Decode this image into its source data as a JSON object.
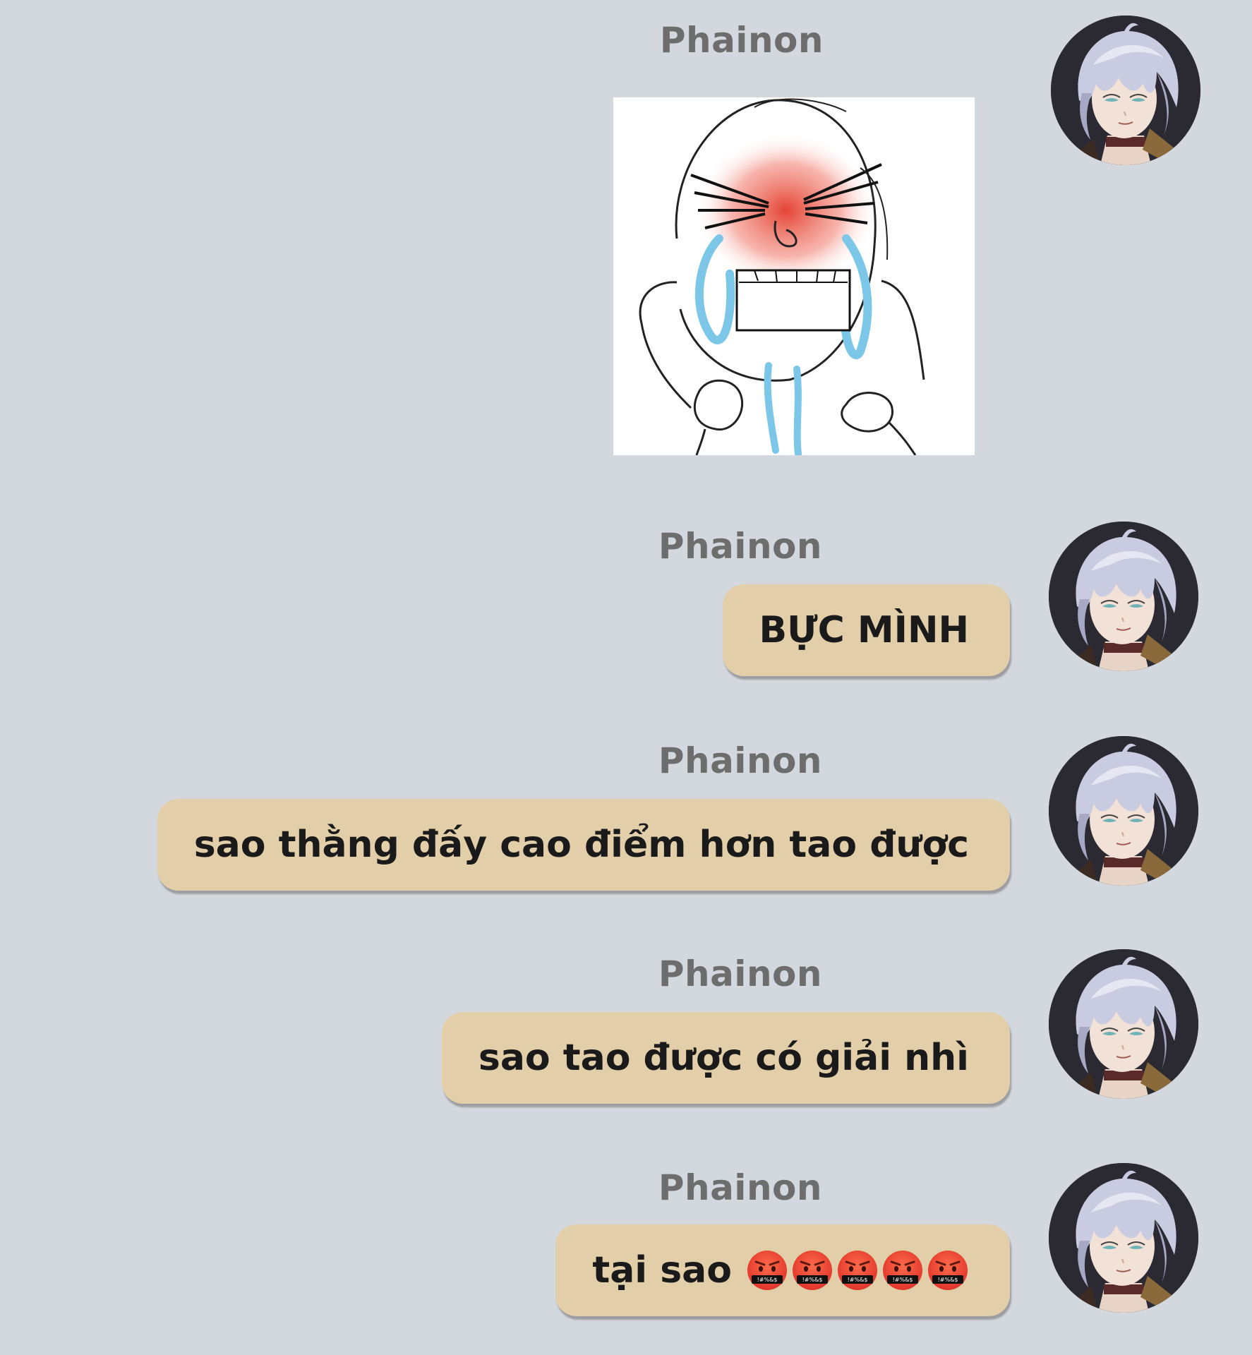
{
  "messages": [
    {
      "sender": "Phainon",
      "type": "sticker",
      "avatar": "phainon-avatar"
    },
    {
      "sender": "Phainon",
      "type": "text",
      "text": "BỰC MÌNH",
      "avatar": "phainon-avatar"
    },
    {
      "sender": "Phainon",
      "type": "text",
      "text": "sao thằng đấy cao điểm hơn tao được",
      "avatar": "phainon-avatar"
    },
    {
      "sender": "Phainon",
      "type": "text",
      "text": "sao tao được có giải nhì",
      "avatar": "phainon-avatar"
    },
    {
      "sender": "Phainon",
      "type": "text",
      "text": "tại sao",
      "emojis": [
        "swearing-face-emoji",
        "swearing-face-emoji",
        "swearing-face-emoji",
        "swearing-face-emoji",
        "swearing-face-emoji"
      ],
      "avatar": "phainon-avatar"
    }
  ],
  "sticker": {
    "icon": "crying-angry-sketch-sticker"
  },
  "colors": {
    "background": "#d3d8de",
    "bubble": "#e2cfa9",
    "sender_name": "#6d6d6d",
    "text": "#1a1a1a"
  }
}
